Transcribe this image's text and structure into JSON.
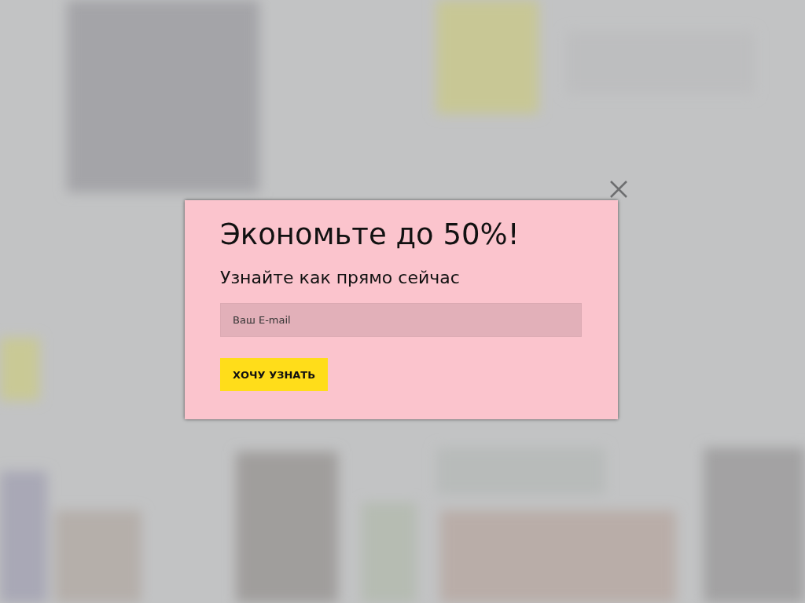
{
  "popup": {
    "title": "Экономьте до 50%!",
    "subtitle": "Узнайте как прямо сейчас",
    "email_field": {
      "placeholder": "Ваш E-mail"
    },
    "submit_button": "ХОЧУ УЗНАТЬ"
  }
}
